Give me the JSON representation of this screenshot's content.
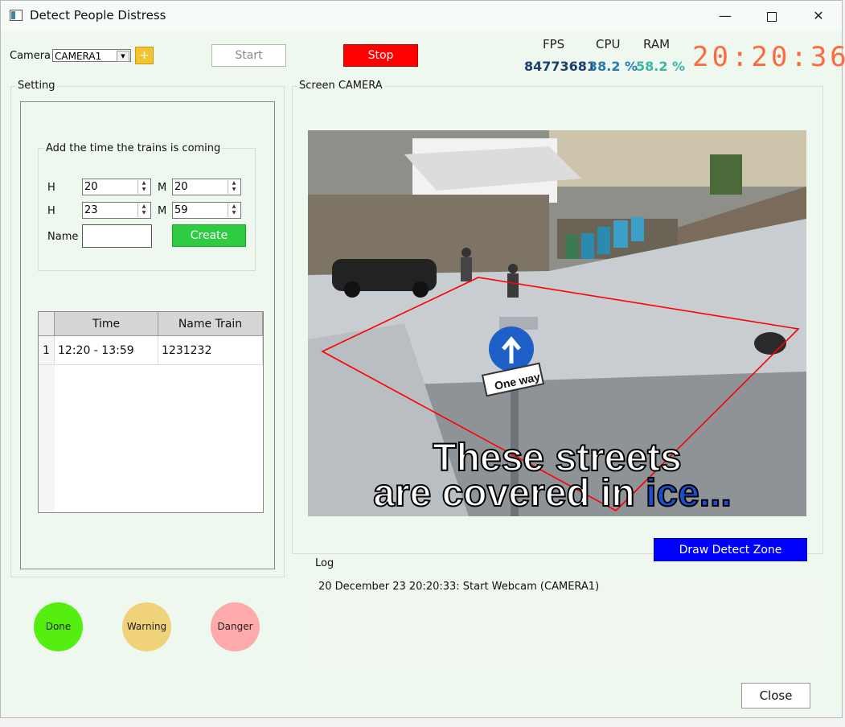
{
  "window": {
    "title": "Detect People Distress",
    "minimize": "—",
    "close": "✕"
  },
  "toolbar": {
    "camera_label": "Camera",
    "camera_value": "CAMERA1",
    "add_label": "+",
    "start_label": "Start",
    "stop_label": "Stop"
  },
  "stats": {
    "fps_label": "FPS",
    "fps_value": "84773681",
    "cpu_label": "CPU",
    "cpu_value": "38.2 %",
    "ram_label": "RAM",
    "ram_value": "58.2 %",
    "clock": "20:20:36",
    "colors": {
      "fps": "#1c3f6e",
      "cpu": "#2a7ab0",
      "ram": "#3ab7a6",
      "clock": "#ff6a3d"
    }
  },
  "setting": {
    "title": "Setting",
    "train_group_title": "Add the time the trains is coming",
    "rows": [
      {
        "h_label": "H",
        "h_value": "20",
        "m_label": "M",
        "m_value": "20"
      },
      {
        "h_label": "H",
        "h_value": "23",
        "m_label": "M",
        "m_value": "59"
      }
    ],
    "name_label": "Name",
    "name_value": "",
    "create_label": "Create",
    "table": {
      "headers": [
        "Time",
        "Name Train"
      ],
      "rows": [
        {
          "index": "1",
          "time": "12:20 - 13:59",
          "name": "1231232"
        }
      ]
    }
  },
  "status": {
    "done_label": "Done",
    "warning_label": "Warning",
    "danger_label": "Danger",
    "colors": {
      "done": "#55ee11",
      "warning": "#f0d27a",
      "danger": "#ffaaaa"
    }
  },
  "camera": {
    "title": "Screen CAMERA",
    "caption_line1": "These streets",
    "caption_line2_a": "are covered in ",
    "caption_line2_b": "ice...",
    "sign_text": "One way",
    "draw_zone_label": "Draw Detect Zone"
  },
  "log": {
    "title": "Log",
    "entries": [
      "20 December 23 20:20:33: Start Webcam (CAMERA1)"
    ]
  },
  "footer": {
    "close_label": "Close"
  }
}
